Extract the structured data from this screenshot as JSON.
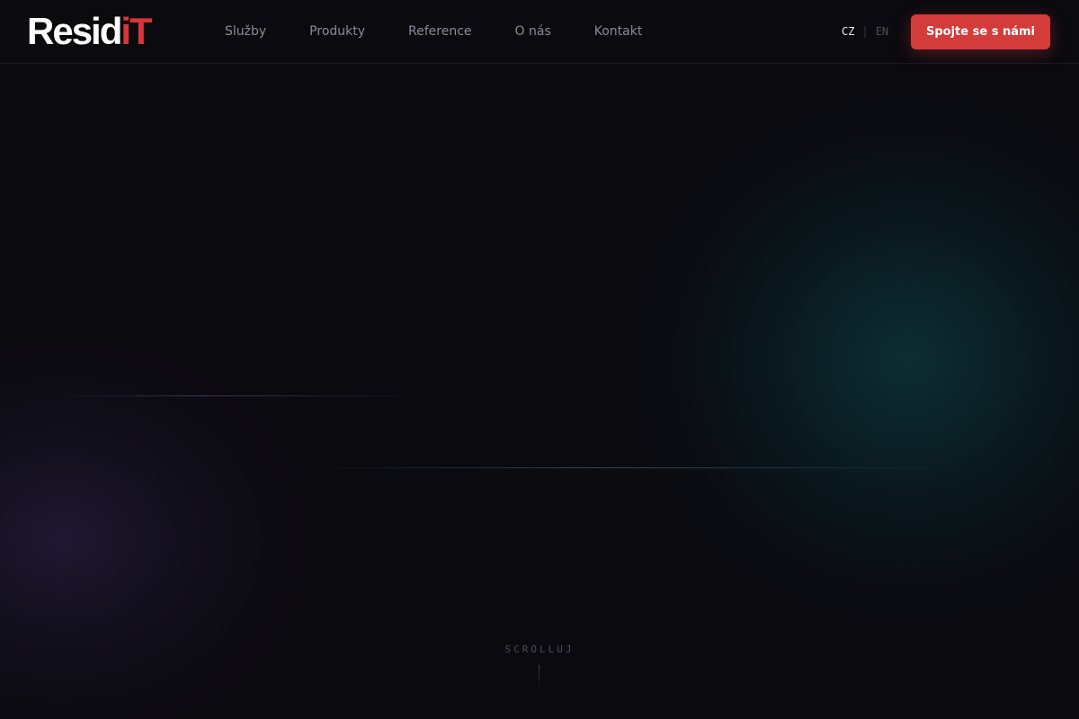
{
  "header": {
    "logo": {
      "text_white": "Resid",
      "text_red": "iT"
    },
    "nav": {
      "items": [
        {
          "label": "Služby"
        },
        {
          "label": "Produkty"
        },
        {
          "label": "Reference"
        },
        {
          "label": "O nás"
        },
        {
          "label": "Kontakt"
        }
      ]
    },
    "language": {
      "active": "CZ",
      "separator": "|",
      "inactive": "EN"
    },
    "cta_label": "Spojte se s námi"
  },
  "hero": {
    "scroll_label": "SCROLLUJ"
  },
  "colors": {
    "background": "#0b0a0f",
    "accent_red": "#d43b3b",
    "glow_teal": "#0c343a",
    "glow_purple": "#201a34"
  }
}
